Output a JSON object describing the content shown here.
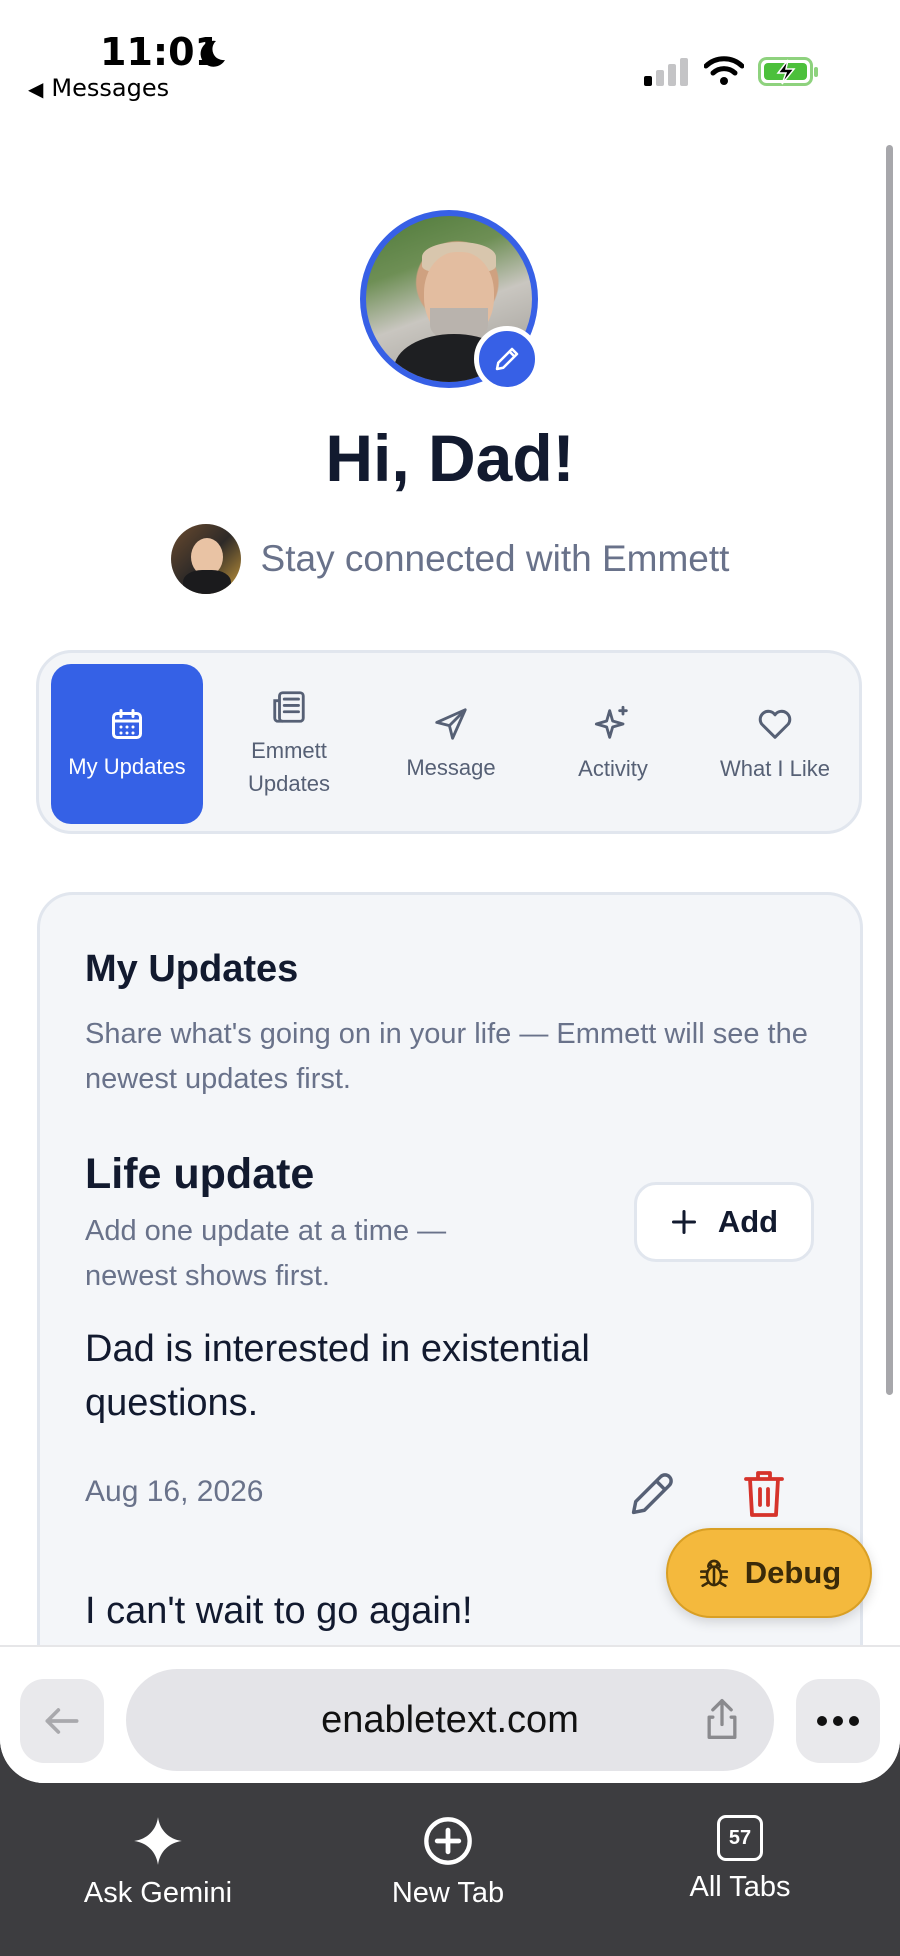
{
  "status_bar": {
    "time": "11:01",
    "back_app": "Messages"
  },
  "profile": {
    "greeting": "Hi, Dad!",
    "subtitle": "Stay connected with Emmett"
  },
  "tabs": [
    {
      "label": "My Updates",
      "icon": "calendar-icon",
      "active": true
    },
    {
      "label": "Emmett Updates",
      "icon": "newspaper-icon",
      "active": false
    },
    {
      "label": "Message",
      "icon": "send-icon",
      "active": false
    },
    {
      "label": "Activity",
      "icon": "sparkles-icon",
      "active": false
    },
    {
      "label": "What I Like",
      "icon": "heart-icon",
      "active": false
    }
  ],
  "card": {
    "title": "My Updates",
    "description": "Share what's going on in your life — Emmett will see the newest updates first.",
    "section_title": "Life update",
    "section_description": "Add one update at a time — newest shows first.",
    "add_label": "Add",
    "updates": [
      {
        "text": "Dad is interested in existential questions.",
        "date": "Aug 16, 2026"
      },
      {
        "text": "I can't wait to go again!"
      }
    ]
  },
  "debug_label": "Debug",
  "browser": {
    "url": "enabletext.com"
  },
  "toolbar": {
    "ask_gemini": "Ask Gemini",
    "new_tab": "New Tab",
    "all_tabs": "All Tabs",
    "tab_count": "57"
  },
  "colors": {
    "accent": "#3561e6",
    "title": "#121a2f",
    "muted": "#69728a",
    "debug": "#f4b93d",
    "delete": "#d6332b"
  }
}
